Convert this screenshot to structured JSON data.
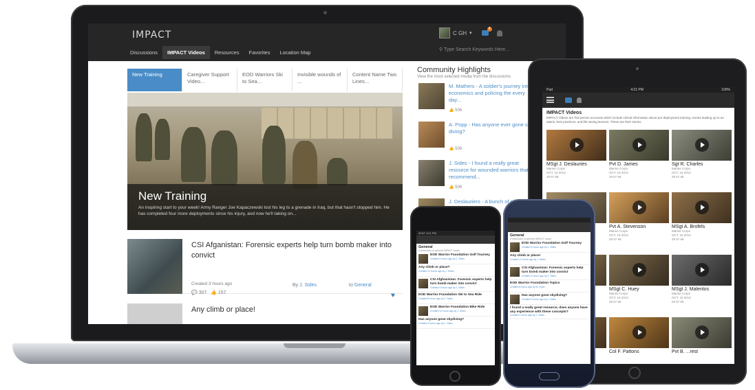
{
  "laptop": {
    "logo": "IMPACT",
    "nav": [
      "Discussions",
      "IMPACT Videos",
      "Resources",
      "Favorites",
      "Location Map"
    ],
    "user_name": "C GH",
    "notification_count": "4",
    "search_placeholder": "Type Search Keywords Here...",
    "tabs": [
      "New Training",
      "Caregiver Support Video...",
      "EOD Warriors Ski to Sea...",
      "Invisible wounds of ...",
      "Content Name Two Lines..."
    ],
    "hero": {
      "title": "New Training",
      "description": "An inspiring start to your week! Army Ranger Joe Kapaczewski lost his leg to a grenade in Iraq, but that hasn't stopped him. He has completed four more deployments since his injury, and now he'll taking on..."
    },
    "posts": [
      {
        "title": "CSI Afganistan: Forensic experts help turn bomb maker into convict",
        "created": "Created 3 hours ago",
        "views": "307",
        "likes": "157",
        "by_label": "By",
        "author": "J. Sides",
        "to_label": "to",
        "group": "General"
      },
      {
        "title": "Any climb or place!"
      }
    ],
    "community": {
      "title": "Community Highlights",
      "subtitle": "View the most selected media from the discussions",
      "items": [
        {
          "text": "M. Mathers - A soldier's journey into economics and policing the every day...",
          "likes": "506"
        },
        {
          "text": "A. Popp - Has anyone ever gone sky diving?",
          "likes": "506"
        },
        {
          "text": "J. Sides - I found a really great resource for wounded warriors that I recommend...",
          "likes": "506"
        },
        {
          "text": "J. Deslauriers - A bunch of pictures of a trip I took last year",
          "likes": ""
        }
      ]
    }
  },
  "tablet": {
    "status_left": "Pad",
    "status_time": "4:21 PM",
    "status_right": "100%",
    "heading": "IMPACT Videos",
    "description": "IMPACT Videos are first person accounts which include critical information about pre-deployment training, events leading up to an attack, best practices, and life-saving lessons. These are their stories.",
    "videos": [
      {
        "name": "MSgt J. Deslauries",
        "branch": "Marine Corps",
        "date": "OCT. 16 2013",
        "stats": "29  57  66"
      },
      {
        "name": "Pvt D. James",
        "branch": "Marine Corps",
        "date": "OCT. 16 2013",
        "stats": "29  57  66"
      },
      {
        "name": "Sgt R. Charles",
        "branch": "Marine Corps",
        "date": "OCT. 16 2013",
        "stats": "29  57  66"
      },
      {
        "name": "",
        "branch": "",
        "date": "",
        "stats": ""
      },
      {
        "name": "Pvt A. Stevenson",
        "branch": "Marine Corps",
        "date": "OCT. 16 2013",
        "stats": "29  57  66"
      },
      {
        "name": "MSgt A. Brofels",
        "branch": "Marine Corps",
        "date": "OCT. 16 2013",
        "stats": "29  57  66"
      },
      {
        "name": "",
        "branch": "",
        "date": "",
        "stats": ""
      },
      {
        "name": "MSgt C. Huey",
        "branch": "Marine Corps",
        "date": "OCT. 16 2013",
        "stats": "29  57  66"
      },
      {
        "name": "MSgt J. Malentos",
        "branch": "Marine Corps",
        "date": "OCT. 16 2013",
        "stats": "29  57  66"
      },
      {
        "name": "",
        "branch": "",
        "date": "",
        "stats": ""
      },
      {
        "name": "Col F. Pattons",
        "branch": "",
        "date": "",
        "stats": ""
      },
      {
        "name": "Pvt B. ...rest",
        "branch": "",
        "date": "",
        "stats": ""
      }
    ]
  },
  "iphone": {
    "status": "AT&T  4:21 PM",
    "title": "General",
    "subtitle": "A discussion of general IMPACT topics",
    "items": [
      {
        "title": "EOD Warrior Foundation Golf Tourney",
        "meta": "Created 9 hours ago by J. Sides"
      },
      {
        "title": "Any climb or place?",
        "meta": "Created 11 hours ago by J. Sides"
      },
      {
        "title": "CSI Afghanistan: Forensic experts help turn bomb maker into convict",
        "meta": "Created 3 hours ago by J. Sides"
      },
      {
        "title": "EOD Warrior Foundation Ski to Sea Ride",
        "meta": "Created 8 hours ago by J. Sides"
      },
      {
        "title": "EOD Warrior Foundation Bike Ride",
        "meta": "Created 11 hours ago by J. Sides"
      },
      {
        "title": "Has anyone gone skydiving?",
        "meta": "Created 3 hours ago by J. Sides"
      }
    ]
  },
  "android": {
    "title": "General",
    "subtitle": "A discussion of general IMPACT topics",
    "items": [
      {
        "title": "EOD Warrior Foundation Golf Tourney",
        "meta": "Created 9 hours ago by J. Sides"
      },
      {
        "title": "Any climb or place!",
        "meta": "Created 11 hours ago by J. Sides"
      },
      {
        "title": "CSI Afghanistan: Forensic experts help turn bomb maker into convict",
        "meta": "Created 3 hours ago by J. Sides"
      },
      {
        "title": "EOD Warrior Foundation Topics",
        "meta": "Created 8 hours ago by M. Ryan"
      },
      {
        "title": "Has anyone gone skydiving?",
        "meta": "Created 3 hours ago by J. Sides"
      },
      {
        "title": "I found a really great resource, does anyone have any experience with these concepts?",
        "meta": "Created 3 hours ago by J. Sides"
      }
    ]
  },
  "colors": {
    "accent": "#4a8cc8",
    "nav_bg": "#262626",
    "badge": "#e07b2a"
  },
  "icons": [
    "avatar",
    "chevron-down-icon",
    "message-icon",
    "bell-icon",
    "search-icon",
    "heart-icon",
    "play-icon",
    "hamburger-icon"
  ]
}
